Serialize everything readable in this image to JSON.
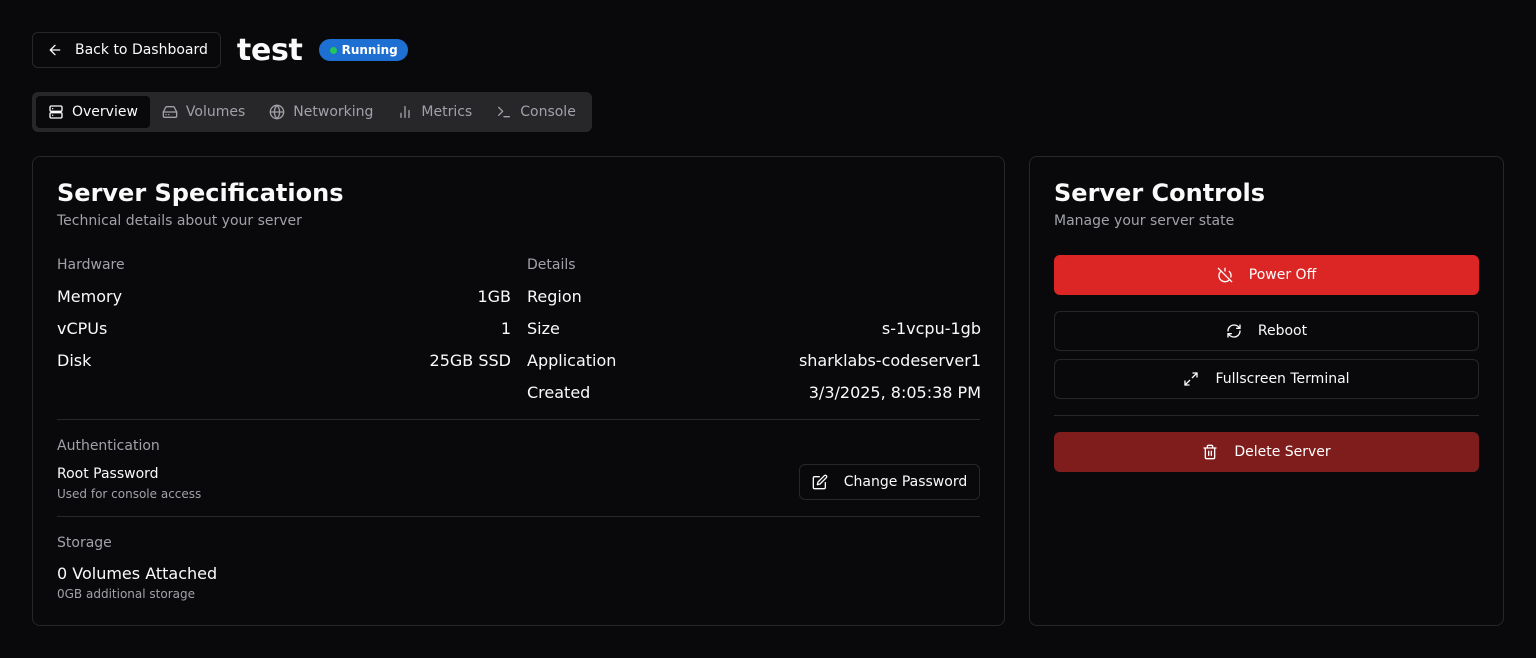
{
  "header": {
    "back_label": "Back to Dashboard",
    "server_name": "test",
    "status": "Running",
    "status_color": "#1d6fd1"
  },
  "tabs": [
    {
      "label": "Overview",
      "icon": "server-icon",
      "active": true
    },
    {
      "label": "Volumes",
      "icon": "hard-drive-icon",
      "active": false
    },
    {
      "label": "Networking",
      "icon": "globe-icon",
      "active": false
    },
    {
      "label": "Metrics",
      "icon": "bar-chart-icon",
      "active": false
    },
    {
      "label": "Console",
      "icon": "terminal-icon",
      "active": false
    }
  ],
  "specs": {
    "title": "Server Specifications",
    "description": "Technical details about your server",
    "hardware": {
      "label": "Hardware",
      "rows": [
        {
          "key": "Memory",
          "value": "1GB"
        },
        {
          "key": "vCPUs",
          "value": "1"
        },
        {
          "key": "Disk",
          "value": "25GB SSD"
        }
      ]
    },
    "details": {
      "label": "Details",
      "rows": [
        {
          "key": "Region",
          "value": ""
        },
        {
          "key": "Size",
          "value": "s-1vcpu-1gb"
        },
        {
          "key": "Application",
          "value": "sharklabs-codeserver1"
        },
        {
          "key": "Created",
          "value": "3/3/2025, 8:05:38 PM"
        }
      ]
    },
    "authentication": {
      "label": "Authentication",
      "title": "Root Password",
      "subtitle": "Used for console access",
      "button_label": "Change Password"
    },
    "storage": {
      "label": "Storage",
      "volumes": "0 Volumes Attached",
      "subtitle": "0GB additional storage"
    }
  },
  "controls": {
    "title": "Server Controls",
    "description": "Manage your server state",
    "power_off_label": "Power Off",
    "reboot_label": "Reboot",
    "fullscreen_label": "Fullscreen Terminal",
    "delete_label": "Delete Server",
    "danger_color": "#dc2626",
    "delete_color": "#7f1d1d"
  }
}
